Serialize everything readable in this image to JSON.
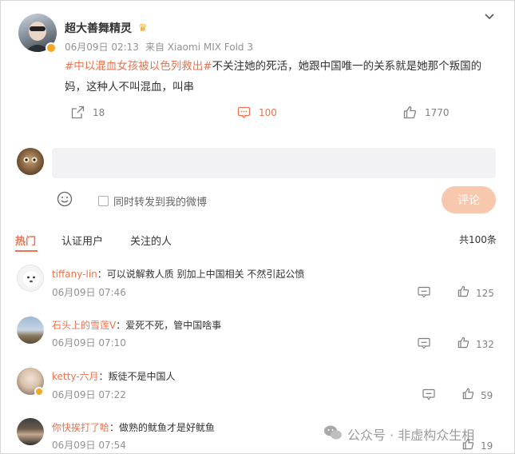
{
  "post": {
    "author": "超大善舞精灵",
    "time": "06月09日 02:13",
    "source": "来自 Xiaomi MIX Fold 3",
    "hashtag": "#中以混血女孩被以色列救出#",
    "text_line1": "不关注她的死活，她跟中国唯一的关系就是她那个叛国的",
    "text_line2": "妈，这种人不叫混血，叫串",
    "repost_count": "18",
    "comment_count": "100",
    "like_count": "1770"
  },
  "composer": {
    "also_repost_label": "同时转发到我的微博",
    "submit_label": "评论"
  },
  "tabs": {
    "hot": "热门",
    "verified": "认证用户",
    "following": "关注的人",
    "total": "共100条"
  },
  "comments": [
    {
      "name": "tiffany-lin",
      "text": "：可以说解救人质 别加上中国相关 不然引起公愤",
      "time": "06月09日 07:46",
      "likes": "125"
    },
    {
      "name": "石头上的雪莲V",
      "text": "：爱死不死，管中国啥事",
      "time": "06月09日 07:10",
      "likes": "132"
    },
    {
      "name": "ketty-六月",
      "text": "：叛徒不是中国人",
      "time": "06月09日 07:22",
      "likes": "59"
    },
    {
      "name": "你快挨打了哈",
      "text": "：做熟的鱿鱼才是好鱿鱼",
      "time": "06月09日 07:54",
      "likes": "19"
    }
  ],
  "watermark": "公众号 · 非虚构众生相",
  "colors": {
    "accent": "#eb7350",
    "submit_disabled": "#f8c8ae",
    "input_bg": "#f2f2f5",
    "badge": "#f5a623"
  }
}
